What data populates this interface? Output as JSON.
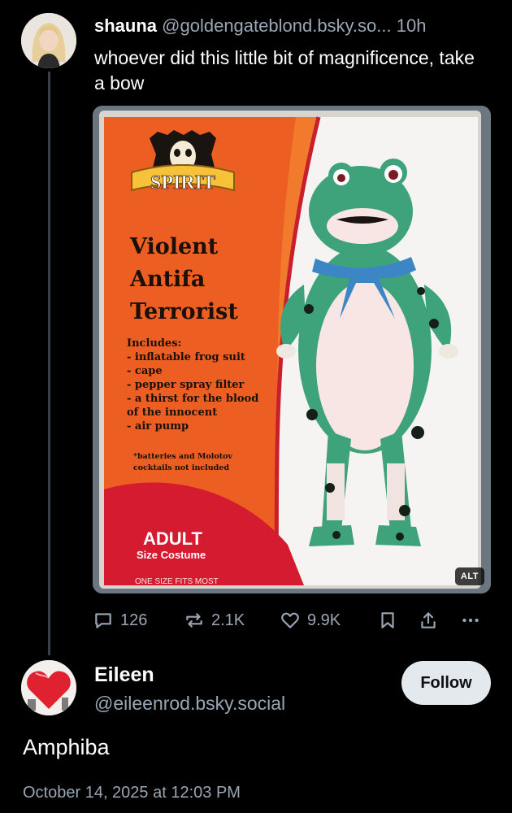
{
  "post": {
    "author_name": "shauna",
    "author_handle": "@goldengateblond.bsky.so...",
    "time": "10h",
    "text": "whoever did this little bit of magnificence, take a bow",
    "image": {
      "brand": "SPIRIT",
      "title_lines": [
        "Violent",
        "Antifa",
        "Terrorist"
      ],
      "includes_heading": "Includes:",
      "includes_lines": [
        "- inflatable frog suit",
        "- cape",
        "- pepper spray filter",
        "- a thirst for the blood",
        "of the innocent",
        "- air pump"
      ],
      "fine_print_lines": [
        "*batteries and Molotov",
        "cocktails not included"
      ],
      "badge_line1": "ADULT",
      "badge_line2": "Size Costume",
      "size_note": "ONE SIZE FITS MOST",
      "alt_label": "ALT"
    },
    "stats": {
      "replies": "126",
      "reposts": "2.1K",
      "likes": "9.9K"
    }
  },
  "reply": {
    "author_name": "Eileen",
    "author_handle": "@eileenrod.bsky.social",
    "follow_label": "Follow",
    "text": "Amphiba",
    "date": "October 14, 2025 at 12:03 PM"
  },
  "colors": {
    "background": "#000000",
    "muted_text": "#9aa6b4",
    "thread_line": "#3a4048",
    "follow_button": "#e4e9ee"
  },
  "icons": [
    "reply-icon",
    "repost-icon",
    "like-icon",
    "bookmark-icon",
    "share-icon",
    "more-icon"
  ]
}
